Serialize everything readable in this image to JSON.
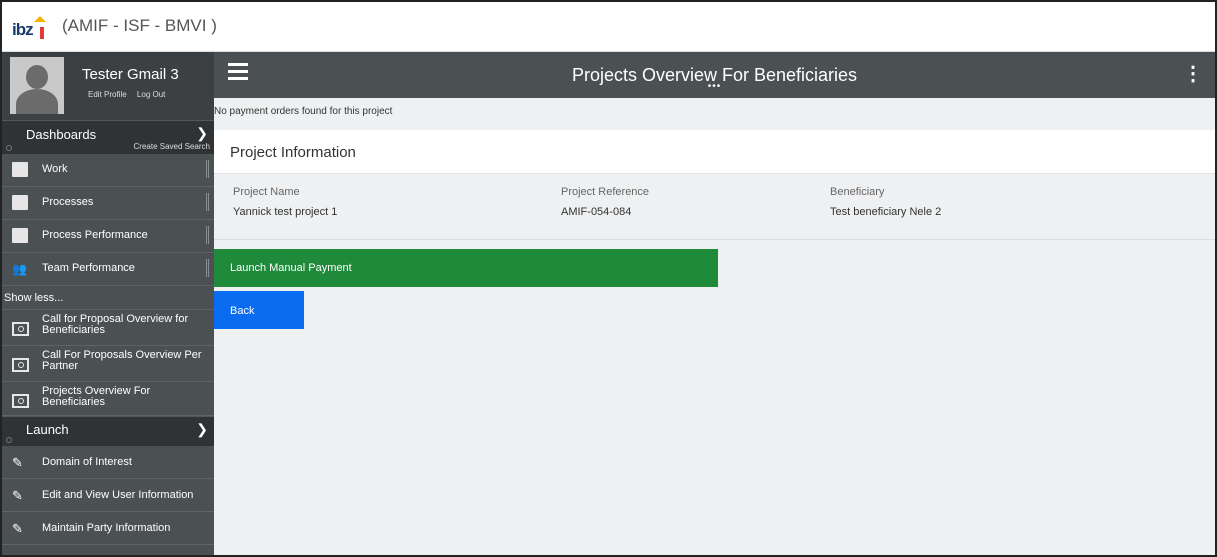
{
  "app": {
    "title": "(AMIF - ISF - BMVI )",
    "logo_text": "ibz"
  },
  "profile": {
    "name": "Tester Gmail 3",
    "edit_profile": "Edit Profile",
    "log_out": "Log Out"
  },
  "dashboards": {
    "label": "Dashboards",
    "saved_search": "Create Saved Search",
    "items": [
      {
        "label": "Work",
        "icon": "work-icon"
      },
      {
        "label": "Processes",
        "icon": "processes-icon"
      },
      {
        "label": "Process Performance",
        "icon": "chart-icon"
      },
      {
        "label": "Team Performance",
        "icon": "team-icon"
      }
    ],
    "show_less": "Show less...",
    "saved": [
      {
        "label": "Call for Proposal Overview for Beneficiaries"
      },
      {
        "label": "Call For Proposals Overview Per Partner"
      },
      {
        "label": "Projects Overview For Beneficiaries"
      }
    ]
  },
  "launch": {
    "label": "Launch",
    "items": [
      {
        "label": "Domain of Interest"
      },
      {
        "label": "Edit and View User Information"
      },
      {
        "label": "Maintain Party Information"
      }
    ]
  },
  "header": {
    "title": "Projects Overview For Beneficiaries",
    "dots": "•••"
  },
  "message": "No payment orders found for this project",
  "project": {
    "section_title": "Project Information",
    "name_label": "Project Name",
    "name_value": "Yannick test project 1",
    "ref_label": "Project Reference",
    "ref_value": "AMIF-054-084",
    "ben_label": "Beneficiary",
    "ben_value": "Test beneficiary Nele 2"
  },
  "actions": {
    "launch_manual_payment": "Launch Manual Payment",
    "back": "Back"
  },
  "colors": {
    "sidebar": "#4b5052",
    "green": "#1f8a3a",
    "blue": "#0a6cf0"
  }
}
